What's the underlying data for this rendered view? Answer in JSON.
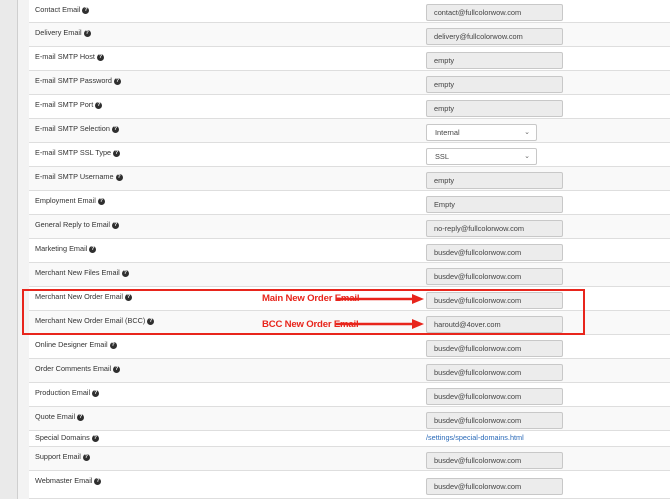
{
  "rows": [
    {
      "label": "Contact Email",
      "control": "text",
      "value": "contact@fullcolorwow.com"
    },
    {
      "label": "Delivery Email",
      "control": "text",
      "value": "delivery@fullcolorwow.com"
    },
    {
      "label": "E-mail SMTP Host",
      "control": "text",
      "value": "empty"
    },
    {
      "label": "E-mail SMTP Password",
      "control": "text",
      "value": "empty"
    },
    {
      "label": "E-mail SMTP Port",
      "control": "text",
      "value": "empty"
    },
    {
      "label": "E-mail SMTP Selection",
      "control": "select",
      "value": "Internal"
    },
    {
      "label": "E-mail SMTP SSL Type",
      "control": "select",
      "value": "SSL"
    },
    {
      "label": "E-mail SMTP Username",
      "control": "text",
      "value": "empty"
    },
    {
      "label": "Employment Email",
      "control": "text",
      "value": "Empty"
    },
    {
      "label": "General Reply to Email",
      "control": "text",
      "value": "no-reply@fullcolorwow.com"
    },
    {
      "label": "Marketing Email",
      "control": "text",
      "value": "busdev@fullcolorwow.com"
    },
    {
      "label": "Merchant New Files Email",
      "control": "text",
      "value": "busdev@fullcolorwow.com"
    },
    {
      "label": "Merchant New Order Email",
      "control": "text",
      "value": "busdev@fullcolorwow.com"
    },
    {
      "label": "Merchant New Order Email (BCC)",
      "control": "text",
      "value": "haroutd@4over.com"
    },
    {
      "label": "Online Designer Email",
      "control": "text",
      "value": "busdev@fullcolorwow.com"
    },
    {
      "label": "Order Comments Email",
      "control": "text",
      "value": "busdev@fullcolorwow.com"
    },
    {
      "label": "Production Email",
      "control": "text",
      "value": "busdev@fullcolorwow.com"
    },
    {
      "label": "Quote Email",
      "control": "text",
      "value": "busdev@fullcolorwow.com"
    },
    {
      "label": "Special Domains",
      "control": "link",
      "value": "/settings/special-domains.html"
    },
    {
      "label": "Support Email",
      "control": "text",
      "value": "busdev@fullcolorwow.com"
    },
    {
      "label": "Webmaster Email",
      "control": "text",
      "value": "busdev@fullcolorwow.com"
    }
  ],
  "help_icon": "question-circle-icon",
  "annotations": {
    "main": "Main New Order Email",
    "bcc": "BCC New Order Email",
    "color": "#e8251c"
  }
}
